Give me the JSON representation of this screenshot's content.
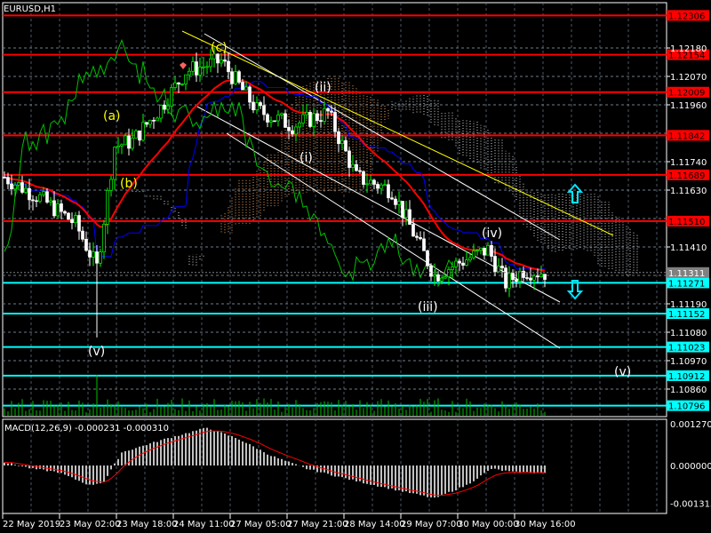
{
  "header": {
    "title": "EURUSD,H1"
  },
  "macd_label": {
    "name": "MACD(12,26,9)",
    "main": "-0.000231",
    "signal": "-0.000310"
  },
  "colors": {
    "bull": "#00ff00",
    "bear": "#ffffff",
    "red_level": "#ff0000",
    "cyan_level": "#00ffff",
    "ma": "#ff0000",
    "kijun": "#0000ff",
    "chikou": "#00c000",
    "cloud_up": "#f4a460",
    "cloud_down": "#d8d8d8",
    "macd_hist": "#c0c0c0",
    "macd_signal": "#ff0000",
    "grid": "#6b7b8b"
  },
  "price_axis": {
    "labels": [
      "1.12180",
      "1.12070",
      "1.11960",
      "1.11740",
      "1.11630",
      "1.11410",
      "1.11190",
      "1.11080",
      "1.10970",
      "1.10860"
    ]
  },
  "macd_axis": {
    "labels": [
      "0.001270",
      "0.000000",
      "-0.001315"
    ]
  },
  "current_price": "1.11311",
  "red_levels": [
    "1.12306",
    "1.12154",
    "1.12009",
    "1.11842",
    "1.11689",
    "1.11510"
  ],
  "cyan_levels": [
    "1.11271",
    "1.11152",
    "1.11023",
    "1.10912",
    "1.10796"
  ],
  "time_axis": [
    {
      "bar": 0,
      "label": "22 May 2019"
    },
    {
      "bar": 16,
      "label": "23 May 02:00"
    },
    {
      "bar": 32,
      "label": "23 May 18:00"
    },
    {
      "bar": 48,
      "label": "24 May 11:00"
    },
    {
      "bar": 64,
      "label": "27 May 05:00"
    },
    {
      "bar": 80,
      "label": "27 May 21:00"
    },
    {
      "bar": 96,
      "label": "28 May 14:00"
    },
    {
      "bar": 112,
      "label": "29 May 07:00"
    },
    {
      "bar": 128,
      "label": "30 May 00:00"
    },
    {
      "bar": 144,
      "label": "30 May 16:00"
    }
  ],
  "wave_labels": [
    {
      "text": "(a)",
      "color": "#ffff00"
    },
    {
      "text": "(b)",
      "color": "#ffff00"
    },
    {
      "text": "(c)",
      "color": "#ffff00"
    },
    {
      "text": "(v)",
      "color": "#ffffff"
    },
    {
      "text": "(i)",
      "color": "#ffffff"
    },
    {
      "text": "(ii)",
      "color": "#ffffff"
    },
    {
      "text": "(iii)",
      "color": "#ffffff"
    },
    {
      "text": "(iv)",
      "color": "#ffffff"
    },
    {
      "text": "(v)",
      "color": "#ffffff"
    }
  ],
  "chart_data": {
    "type": "candlestick",
    "symbol": "EURUSD",
    "timeframe": "H1",
    "ylim": [
      1.1075,
      1.124
    ],
    "price_path": [
      [
        0,
        1.1168
      ],
      [
        10,
        1.116
      ],
      [
        20,
        1.115
      ],
      [
        26,
        1.1133
      ],
      [
        31,
        1.118
      ],
      [
        36,
        1.1182
      ],
      [
        44,
        1.1195
      ],
      [
        51,
        1.1209
      ],
      [
        61,
        1.1213
      ],
      [
        71,
        1.1194
      ],
      [
        81,
        1.1188
      ],
      [
        91,
        1.1193
      ],
      [
        99,
        1.1168
      ],
      [
        109,
        1.1163
      ],
      [
        121,
        1.113
      ],
      [
        128,
        1.1135
      ],
      [
        136,
        1.114
      ],
      [
        141,
        1.1127
      ],
      [
        146,
        1.1132
      ],
      [
        152,
        1.1131
      ]
    ],
    "macd_path": [
      [
        0,
        0.0001
      ],
      [
        8,
        -0.0001
      ],
      [
        15,
        -0.0002
      ],
      [
        24,
        -0.0006
      ],
      [
        28,
        -0.0005
      ],
      [
        33,
        0.0004
      ],
      [
        45,
        0.0008
      ],
      [
        57,
        0.00115
      ],
      [
        66,
        0.0008
      ],
      [
        75,
        0.0003
      ],
      [
        85,
        -0.0001
      ],
      [
        100,
        -0.0005
      ],
      [
        121,
        -0.001
      ],
      [
        130,
        -0.0006
      ],
      [
        137,
        -0.0001
      ],
      [
        143,
        -0.0002
      ],
      [
        152,
        -0.00023
      ]
    ],
    "macd_ylim": [
      -0.001315,
      0.00127
    ],
    "bars": 153
  }
}
